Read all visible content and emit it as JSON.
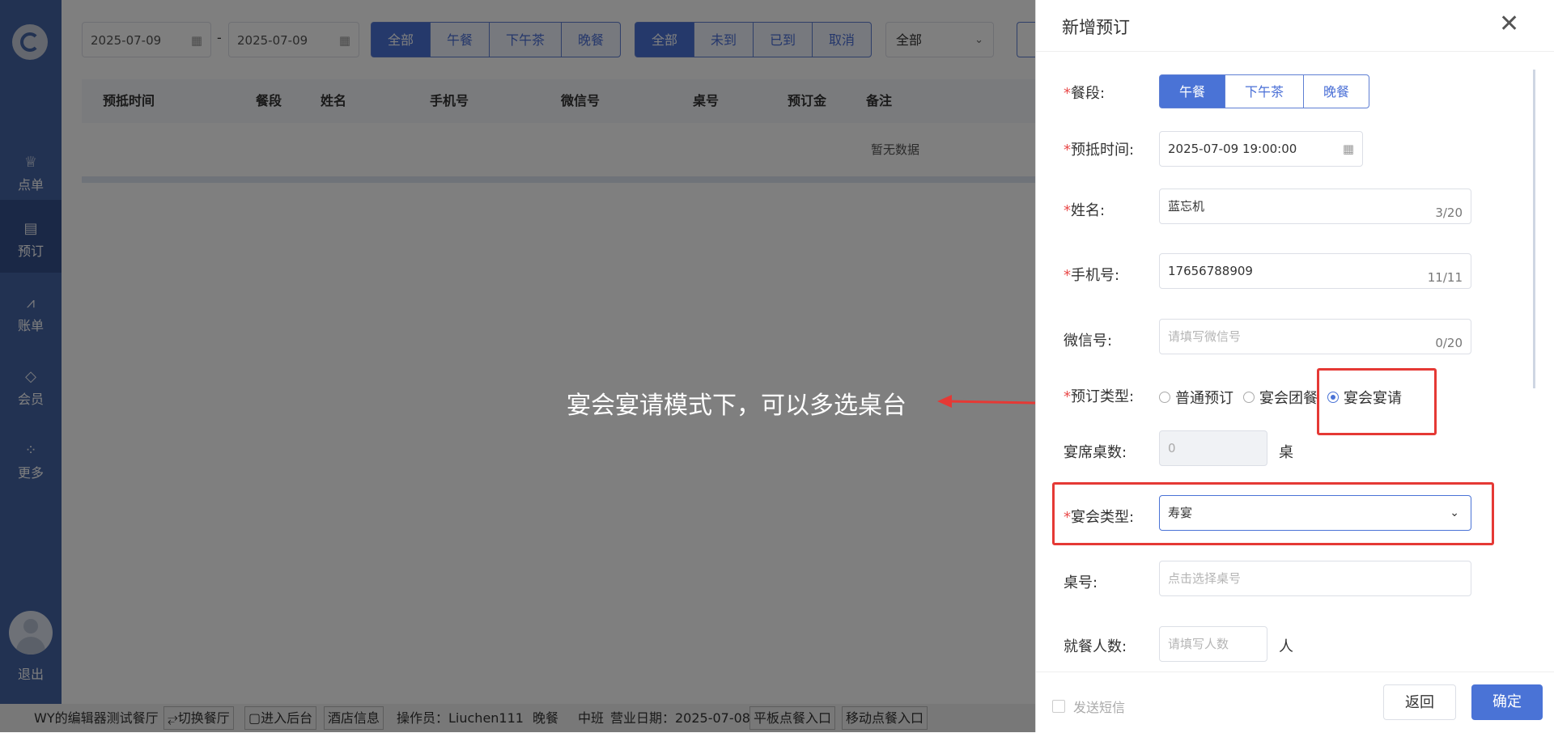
{
  "sidebar": {
    "items": [
      {
        "icon": "chef-hat-icon",
        "label": "点单"
      },
      {
        "icon": "book-icon",
        "label": "预订"
      },
      {
        "icon": "chart-icon",
        "label": "账单"
      },
      {
        "icon": "diamond-icon",
        "label": "会员"
      },
      {
        "icon": "grid-icon",
        "label": "更多"
      }
    ],
    "logout": "退出"
  },
  "filters": {
    "date_start": "2025-07-09",
    "date_sep": "-",
    "date_end": "2025-07-09",
    "meal_buttons": [
      "全部",
      "午餐",
      "下午茶",
      "晚餐"
    ],
    "status_buttons": [
      "全部",
      "未到",
      "已到",
      "取消"
    ],
    "select_value": "全部"
  },
  "table": {
    "headers": [
      "预抵时间",
      "餐段",
      "姓名",
      "手机号",
      "微信号",
      "桌号",
      "预订金",
      "备注"
    ],
    "empty_text": "暂无数据"
  },
  "annotation": {
    "text": "宴会宴请模式下，可以多选桌台",
    "color": "#e53935"
  },
  "statusbar": {
    "restaurant": "WY的编辑器测试餐厅",
    "switch": "⥂切换餐厅",
    "backend": "▢进入后台",
    "hotel_info": "酒店信息",
    "operator": "操作员：Liuchen111",
    "meal": "晚餐",
    "shift": "中班",
    "business_date": "营业日期：2025-07-08",
    "tablet_entry": "平板点餐入口",
    "mobile_entry": "移动点餐入口"
  },
  "drawer": {
    "title": "新增预订",
    "meal_label": "餐段:",
    "meal_options": [
      "午餐",
      "下午茶",
      "晚餐"
    ],
    "meal_selected": "午餐",
    "time_label": "预抵时间:",
    "time_value": "2025-07-09 19:00:00",
    "name_label": "姓名:",
    "name_value": "蓝忘机",
    "name_count": "3/20",
    "phone_label": "手机号:",
    "phone_value": "17656788909",
    "phone_count": "11/11",
    "wechat_label": "微信号:",
    "wechat_placeholder": "请填写微信号",
    "wechat_count": "0/20",
    "type_label": "预订类型:",
    "type_options": [
      "普通预订",
      "宴会团餐",
      "宴会宴请"
    ],
    "type_selected": "宴会宴请",
    "tables_label": "宴席桌数:",
    "tables_value": "0",
    "tables_unit": "桌",
    "banquet_label": "宴会类型:",
    "banquet_value": "寿宴",
    "tableno_label": "桌号:",
    "tableno_placeholder": "点击选择桌号",
    "guests_label": "就餐人数:",
    "guests_placeholder": "请填写人数",
    "guests_unit": "人",
    "sms_label": "发送短信",
    "back_button": "返回",
    "ok_button": "确定"
  },
  "colors": {
    "sidebar": "#4564a5",
    "primary": "#4a73d6",
    "annotation_red": "#e53935"
  }
}
